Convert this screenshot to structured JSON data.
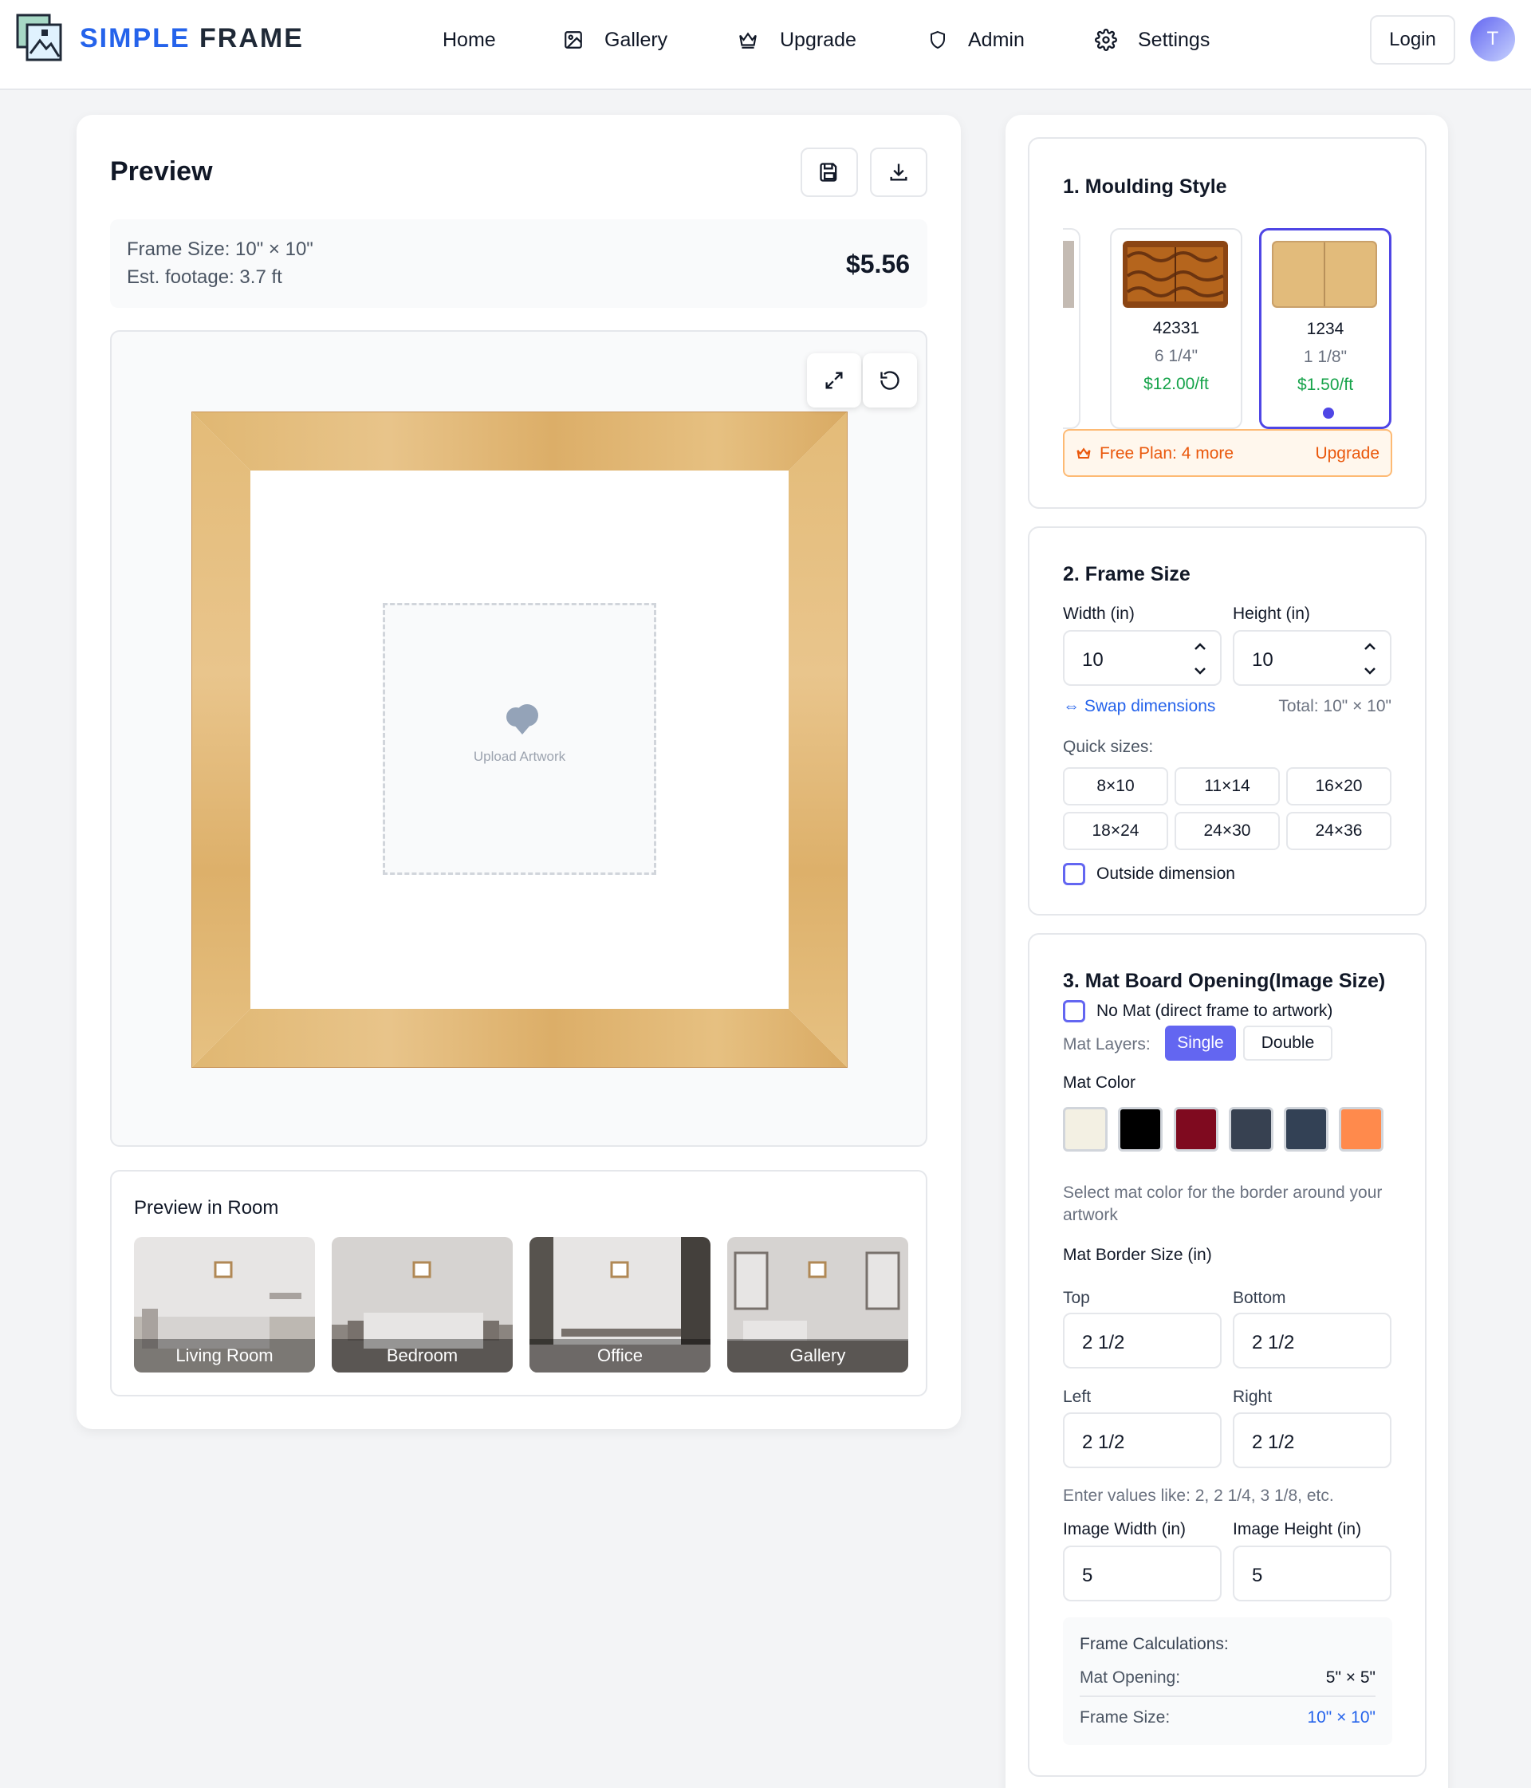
{
  "header": {
    "brand_part1": "SIMPLE",
    "brand_part2": "FRAME",
    "nav": {
      "home": "Home",
      "gallery": "Gallery",
      "upgrade": "Upgrade",
      "admin": "Admin",
      "settings": "Settings"
    },
    "login_label": "Login",
    "avatar_initial": "T"
  },
  "preview": {
    "title": "Preview",
    "frame_size_text": "Frame Size: 10\" × 10\"",
    "footage_text": "Est. footage: 3.7 ft",
    "price": "$5.56",
    "upload_label": "Upload Artwork",
    "room_title": "Preview in Room",
    "rooms": [
      "Living Room",
      "Bedroom",
      "Office",
      "Gallery"
    ]
  },
  "moulding": {
    "title": "1. Moulding Style",
    "items": [
      {
        "code": "42331",
        "size": "6 1/4\"",
        "price": "$12.00/ft"
      },
      {
        "code": "1234",
        "size": "1 1/8\"",
        "price": "$1.50/ft"
      }
    ],
    "selected": "1234",
    "plan_text": "Free Plan: 4 more",
    "upgrade_label": "Upgrade"
  },
  "frame_size": {
    "title": "2. Frame Size",
    "width_label": "Width (in)",
    "height_label": "Height (in)",
    "width": "10",
    "height": "10",
    "swap_label": "⇔ Swap dimensions",
    "total_text": "Total: 10\" × 10\"",
    "quick_label": "Quick sizes:",
    "quick_sizes": [
      "8×10",
      "11×14",
      "16×20",
      "18×24",
      "24×30",
      "24×36"
    ],
    "outside_label": "Outside dimension"
  },
  "mat": {
    "title": "3. Mat Board Opening(Image Size)",
    "no_mat_label": "No Mat (direct frame to artwork)",
    "layers_label": "Mat Layers:",
    "layer_single": "Single",
    "layer_double": "Double",
    "color_label": "Mat Color",
    "colors": [
      "#f3f0e3",
      "#000000",
      "#7f0a1f",
      "#374151",
      "#334155",
      "#ff8a4c"
    ],
    "color_hint": "Select mat color for the border around your artwork",
    "border_label": "Mat Border Size (in)",
    "top_label": "Top",
    "bottom_label": "Bottom",
    "left_label": "Left",
    "right_label": "Right",
    "top": "2 1/2",
    "bottom": "2 1/2",
    "left": "2 1/2",
    "right": "2 1/2",
    "values_hint": "Enter values like: 2, 2 1/4, 3 1/8, etc.",
    "img_w_label": "Image Width (in)",
    "img_h_label": "Image Height (in)",
    "img_w": "5",
    "img_h": "5",
    "calc_title": "Frame Calculations:",
    "mat_opening_label": "Mat Opening:",
    "mat_opening_value": "5\" × 5\"",
    "frame_size_label": "Frame Size:",
    "frame_size_value": "10\" × 10\""
  }
}
